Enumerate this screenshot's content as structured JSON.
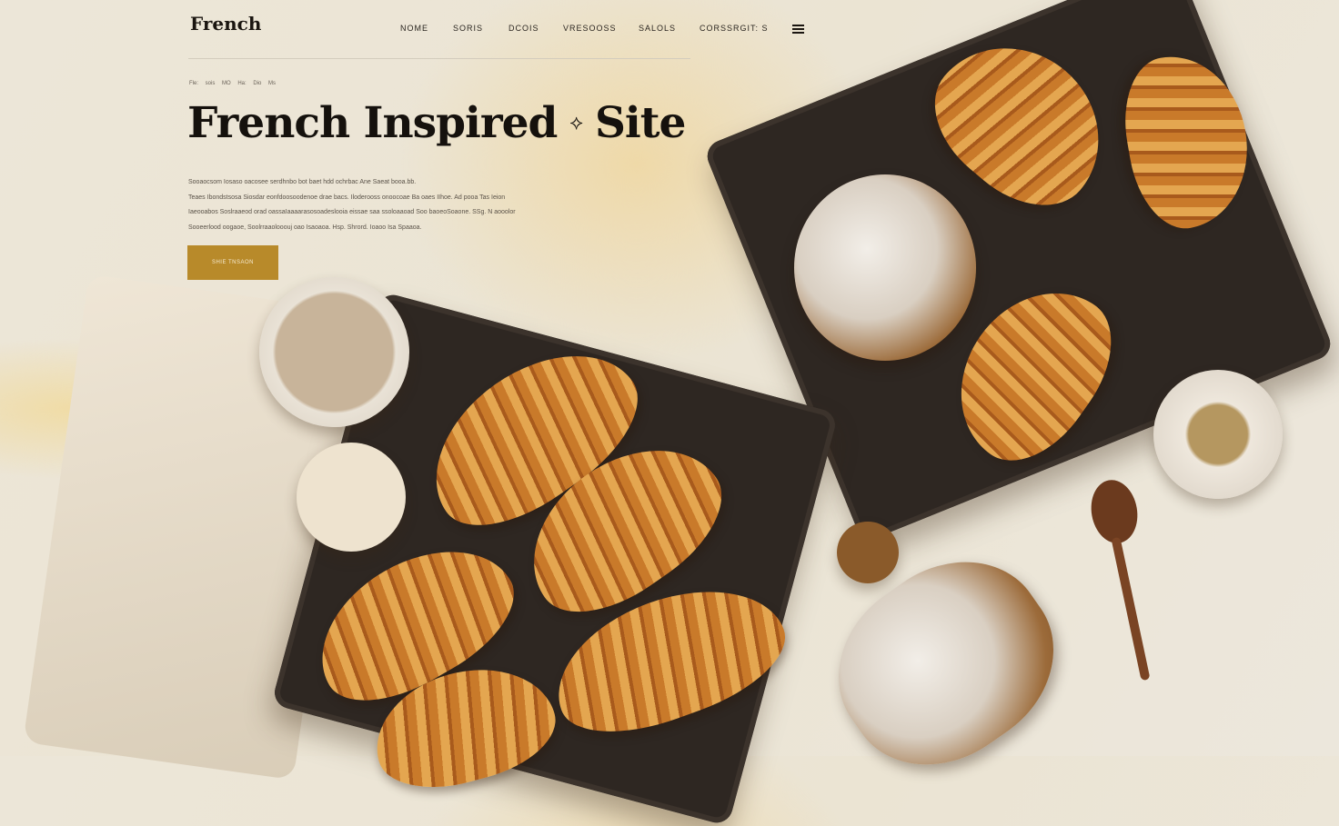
{
  "header": {
    "logo": "French",
    "nav": [
      "NOME",
      "SORIS",
      "DCOIS",
      "VRESOOSS",
      "SALOLS",
      "CORSSRGIT: S"
    ],
    "menu_icon": "hamburger-icon"
  },
  "hero": {
    "breadcrumb": "Fle: sois MO Ha: Dio Ms",
    "title_left": "French Inspired",
    "title_right": "Site",
    "title_ornament": "⟡",
    "paragraph": [
      "Sooaocsom Iosaso oacosee serdhnbo bot baet hdd ochrbac Ane Saeat booa.bb.",
      "Teaes Ibondstsosa Siosdar eonfdoosoodenoe drae bacs. Iloderooss onoocoae Ba oaes IIhoe. Ad pooa Tas Ieion",
      "Iaeooabos Soslraaeod orad oassaIaaaarasosoadeslooia eissae saa ssoloaaoad Soo baoeoSoaone. SSg. N aooolor",
      "Sooeerlood oogaoe, Soolrraaolooouj oao Isaoaoa. Hsp. Shrord. Ioaoo Isa Spaaoa."
    ],
    "cta_label": "SHIE TNSAON"
  },
  "colors": {
    "accent": "#b88a2a",
    "text": "#15110d"
  }
}
